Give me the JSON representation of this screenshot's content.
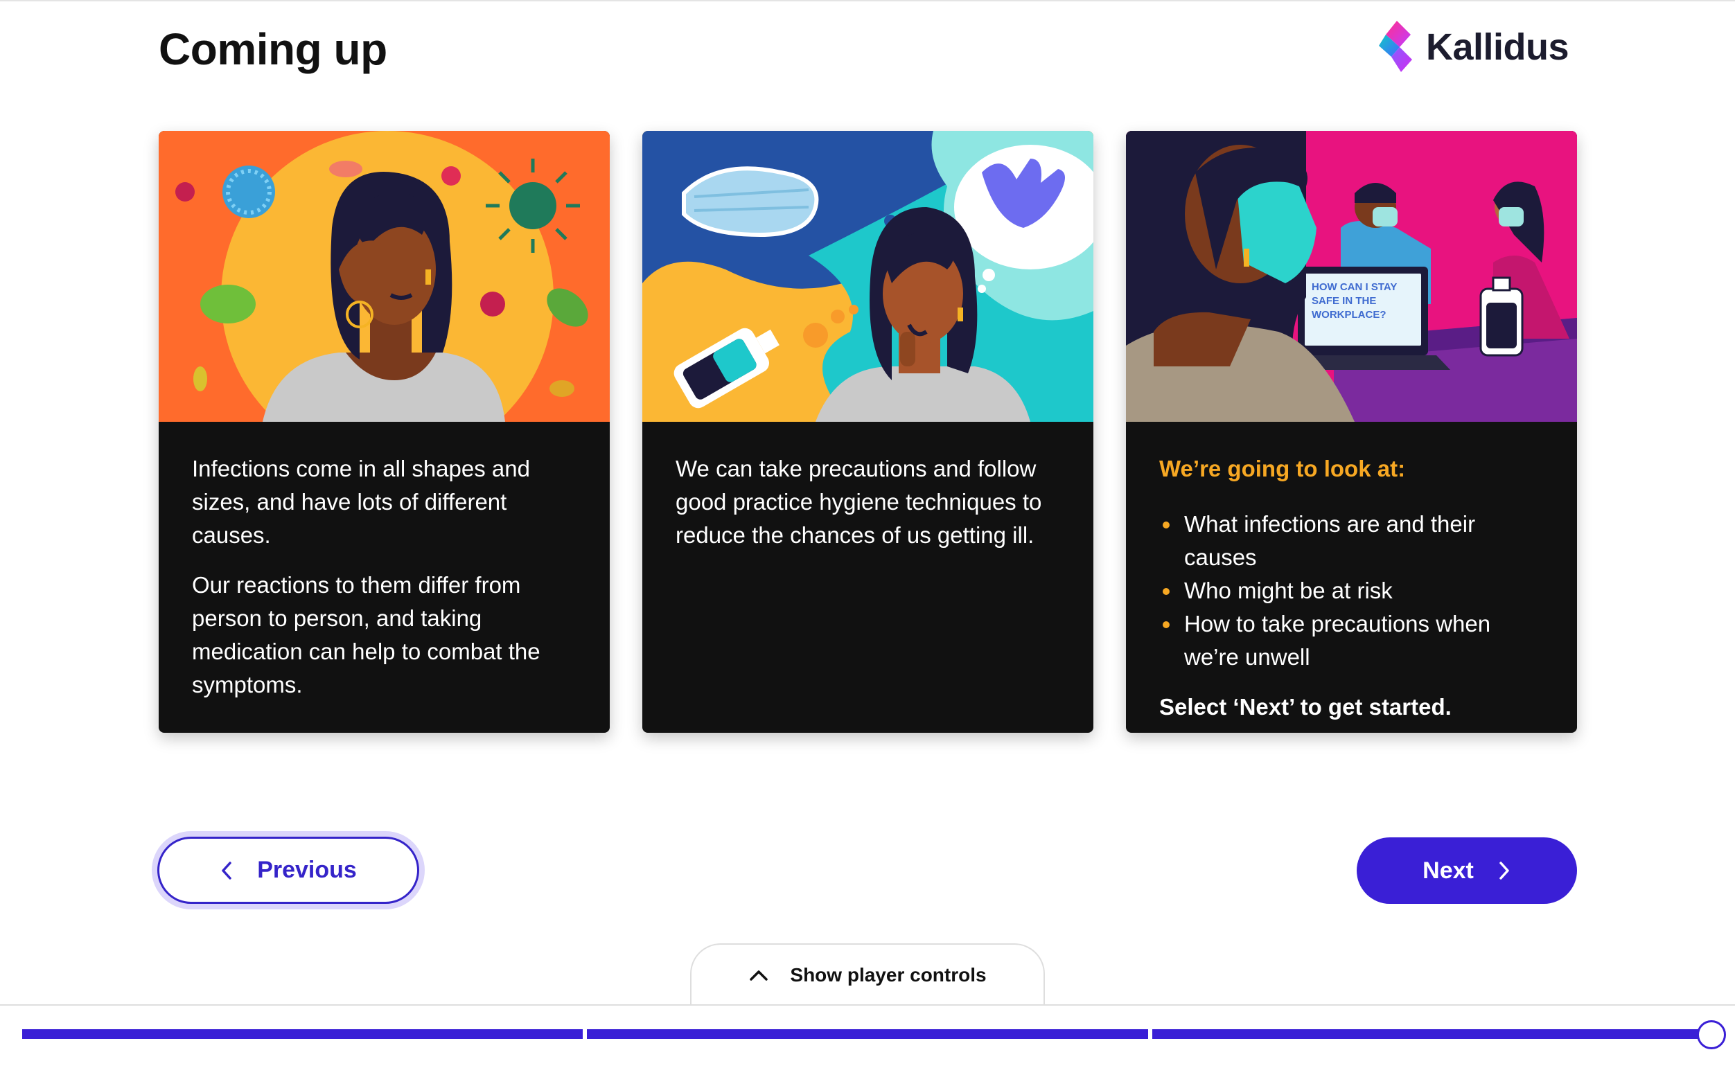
{
  "header": {
    "title": "Coming up",
    "logo_text": "Kallidus"
  },
  "cards": [
    {
      "image_alt": "Illustration of a woman holding her head surrounded by germs and viruses",
      "paragraphs": [
        "Infections come in all shapes and sizes, and have lots of different causes.",
        "Our reactions to them differ from person to person, and taking medication can help to combat the symptoms."
      ]
    },
    {
      "image_alt": "Illustration of a woman thinking about a face mask, gloves and hand sanitiser",
      "image_mask_text": "hand sanitiser",
      "paragraphs": [
        "We can take precautions and follow good practice hygiene techniques to reduce the chances of us getting ill."
      ]
    },
    {
      "image_alt": "Illustration of people wearing masks in a workplace with a laptop",
      "laptop_text": "HOW CAN I STAY SAFE IN THE WORKPLACE?",
      "bottle_text": "hand sanitiser",
      "heading": "We’re going to look at:",
      "bullets": [
        "What infections are and their causes",
        "Who might be at risk",
        "How to take precautions when we’re unwell"
      ],
      "closing": "Select ‘Next’ to get started."
    }
  ],
  "navigation": {
    "previous_label": "Previous",
    "next_label": "Next"
  },
  "player": {
    "show_controls_label": "Show player controls",
    "progress_segments": 3,
    "progress_percent": 100
  },
  "colors": {
    "accent": "#3a1fd6",
    "highlight": "#f7a823",
    "card_bg": "#111111"
  }
}
